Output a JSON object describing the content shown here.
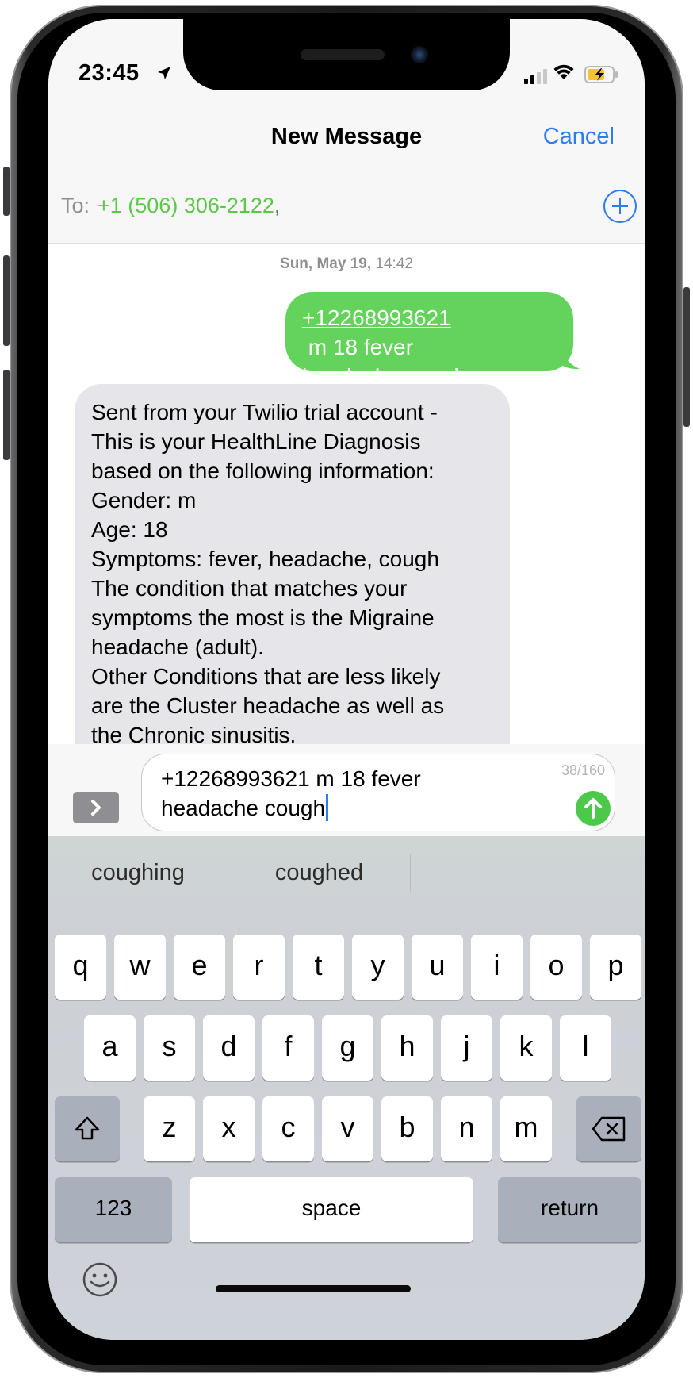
{
  "status": {
    "time": "23:45"
  },
  "nav": {
    "title": "New Message",
    "cancel": "Cancel"
  },
  "to": {
    "label": "To:",
    "number": "+1 (506) 306-2122",
    "separator": ","
  },
  "thread": {
    "date": "Sun, May 19,",
    "time": "14:42",
    "outgoing": {
      "link": "+12268993621",
      "text_line1_rest": " m 18 fever",
      "text_line2": "headache cough"
    },
    "incoming_lines": [
      "Sent from your Twilio trial account -",
      "This is your HealthLine Diagnosis",
      "based on the following information:",
      "Gender: m",
      "Age: 18",
      "Symptoms: fever, headache, cough",
      "The condition that matches your",
      "symptoms the most is the Migraine",
      "headache (adult).",
      "Other Conditions that are less likely",
      "are the Cluster headache as well as",
      "the Chronic sinusitis."
    ]
  },
  "compose": {
    "line1": "+12268993621 m 18 fever",
    "line2": "headache cough",
    "counter": "38/160"
  },
  "keyboard": {
    "suggestions": [
      "coughing",
      "coughed",
      ""
    ],
    "row1": [
      "q",
      "w",
      "e",
      "r",
      "t",
      "y",
      "u",
      "i",
      "o",
      "p"
    ],
    "row2": [
      "a",
      "s",
      "d",
      "f",
      "g",
      "h",
      "j",
      "k",
      "l"
    ],
    "row3": [
      "z",
      "x",
      "c",
      "v",
      "b",
      "n",
      "m"
    ],
    "numbers_key": "123",
    "space_key": "space",
    "return_key": "return"
  },
  "colors": {
    "imessage_green": "#63d35b",
    "incoming_gray": "#e5e5ea",
    "ios_blue": "#2f7bf5",
    "keyboard_bg": "#cfd4d9"
  },
  "icons": [
    "location-arrow-icon",
    "signal-icon",
    "wifi-icon",
    "battery-charging-icon",
    "plus-circle-icon",
    "chevron-right-icon",
    "send-arrow-icon",
    "shift-icon",
    "backspace-icon",
    "emoji-icon"
  ]
}
